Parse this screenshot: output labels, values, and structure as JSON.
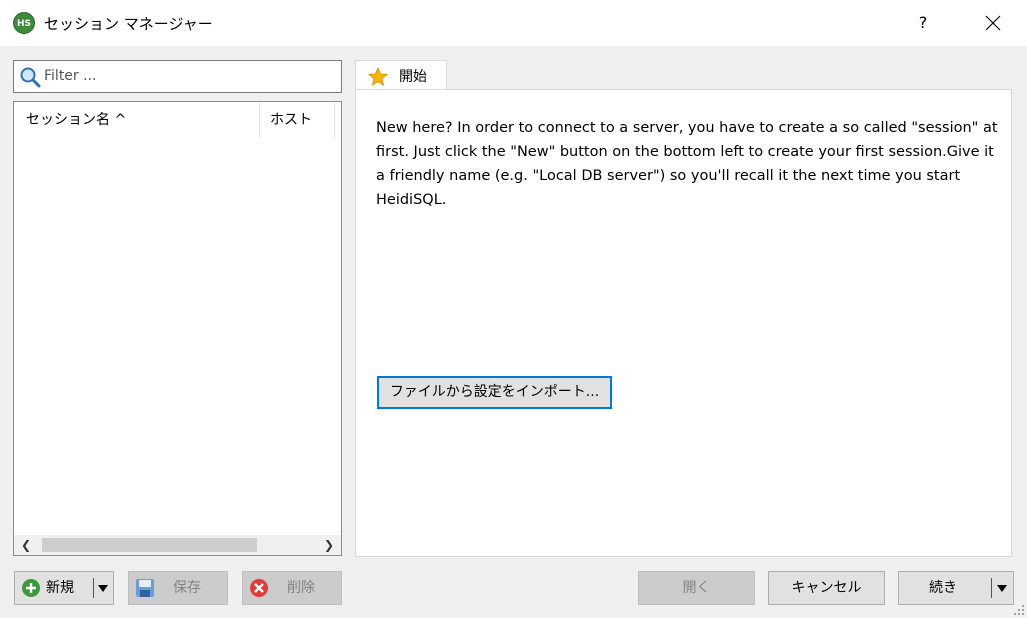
{
  "window": {
    "app_icon_text": "HS",
    "title": "セッション マネージャー",
    "help_label": "?"
  },
  "filter": {
    "placeholder": "Filter ...",
    "value": ""
  },
  "session_list": {
    "columns": [
      "セッション名 ^",
      "ホスト"
    ]
  },
  "tabs": [
    {
      "label": "開始",
      "icon": "star-icon"
    }
  ],
  "start_tab": {
    "intro": "New here? In order to connect to a server, you have to create a so called \"session\" at first. Just click the \"New\" button on the bottom left to create your first session.Give it a friendly name (e.g. \"Local DB server\") so you'll recall it the next time you start HeidiSQL.",
    "import_button": "ファイルから設定をインポート..."
  },
  "buttons": {
    "new": "新規",
    "save": "保存",
    "delete": "削除",
    "open": "開く",
    "cancel": "キャンセル",
    "continue": "続き"
  },
  "colors": {
    "accent": "#0078d7",
    "new_icon": "#3c9a3c",
    "delete_icon": "#e03c3c",
    "star": "#f7b500"
  }
}
